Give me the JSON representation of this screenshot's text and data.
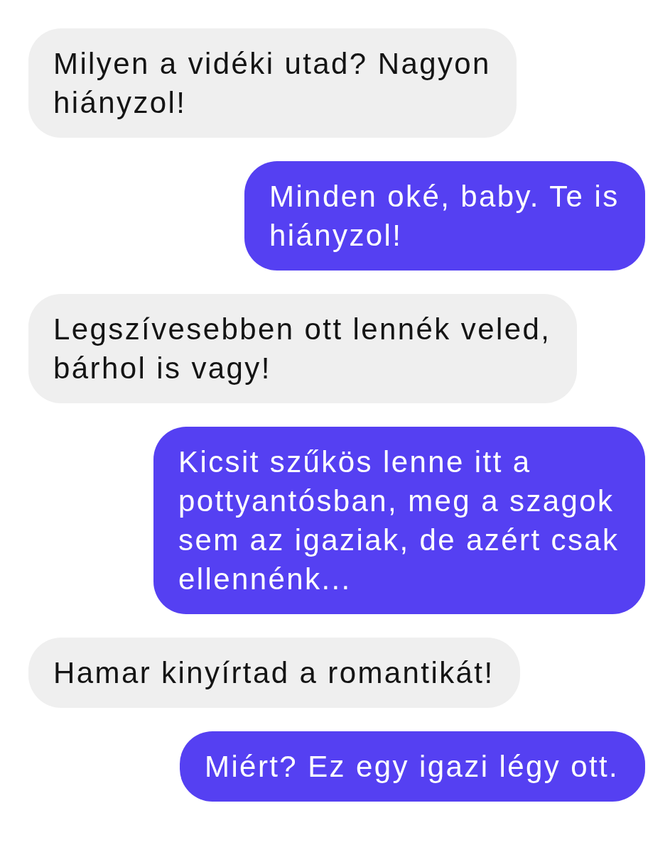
{
  "messages": [
    {
      "kind": "received",
      "text": "Milyen a vidéki utad? Nagyon hiányzol!"
    },
    {
      "kind": "sent",
      "text": "Minden oké, baby. Te is hiányzol!"
    },
    {
      "kind": "received",
      "text": "Legszívesebben ott lennék veled, bárhol is vagy!"
    },
    {
      "kind": "sent",
      "text": "Kicsit szűkös lenne itt a pottyantósban, meg a szagok sem az igaziak, de azért csak ellennénk..."
    },
    {
      "kind": "received",
      "text": "Hamar kinyírtad a romantikát!"
    },
    {
      "kind": "sent",
      "text": "Miért? Ez egy igazi légy ott."
    }
  ]
}
